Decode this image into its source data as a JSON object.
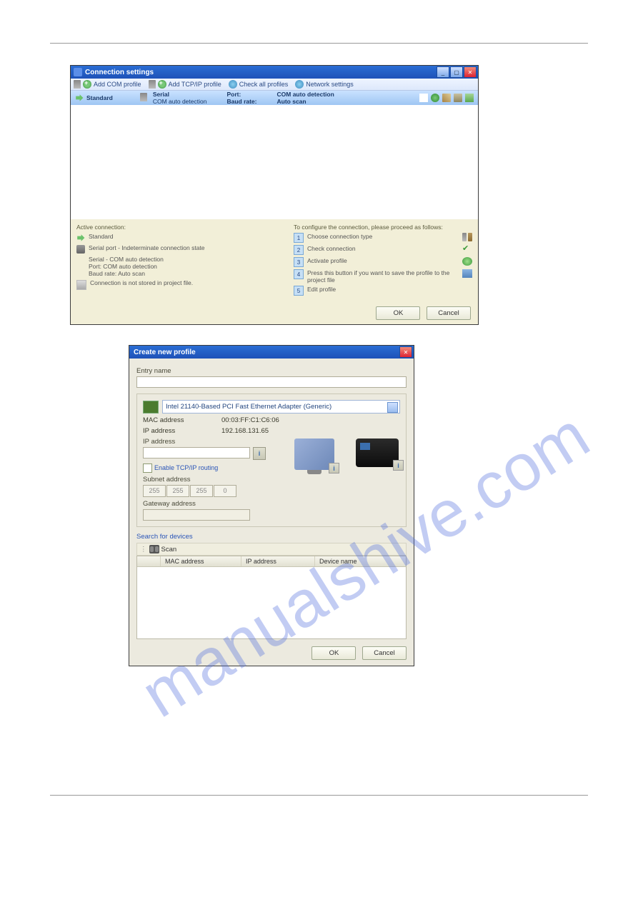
{
  "watermark": "manualshive.com",
  "dialog1": {
    "title": "Connection settings",
    "toolbar": {
      "add_com": "Add COM profile",
      "add_tcp": "Add TCP/IP profile",
      "check_all": "Check all profiles",
      "network": "Network settings"
    },
    "profile": {
      "name": "Standard",
      "col2a": "Serial",
      "col2b": "COM auto detection",
      "col3a": "Port:",
      "col3b": "Baud rate:",
      "col4a": "COM auto detection",
      "col4b": "Auto scan"
    },
    "left": {
      "header": "Active connection:",
      "name": "Standard",
      "state": "Serial port - Indeterminate connection state",
      "details1": "Serial - COM auto detection",
      "details2": "Port: COM auto detection",
      "details3": "Baud rate: Auto scan",
      "stored": "Connection is not stored in project file."
    },
    "right": {
      "header": "To configure the connection, please proceed as follows:",
      "s1": "Choose connection type",
      "s2": "Check connection",
      "s3": "Activate profile",
      "s4": "Press this button if you want to save the profile to the project file",
      "s5": "Edit profile"
    },
    "ok": "OK",
    "cancel": "Cancel"
  },
  "dialog2": {
    "title": "Create new profile",
    "entry_name": "Entry name",
    "adapter": "Intel 21140-Based PCI Fast Ethernet Adapter (Generic)",
    "mac_label": "MAC address",
    "mac_value": "00:03:FF:C1:C6:06",
    "ipaddr_ro_label": "IP address",
    "ipaddr_ro_value": "192.168.131.65",
    "ipaddr_label": "IP address",
    "routing": "Enable TCP/IP routing",
    "subnet_label": "Subnet address",
    "subnet": [
      "255",
      "255",
      "255",
      "0"
    ],
    "gateway_label": "Gateway address",
    "search": "Search for devices",
    "scan": "Scan",
    "cols": {
      "mac": "MAC address",
      "ip": "IP address",
      "dev": "Device name"
    },
    "ok": "OK",
    "cancel": "Cancel"
  }
}
